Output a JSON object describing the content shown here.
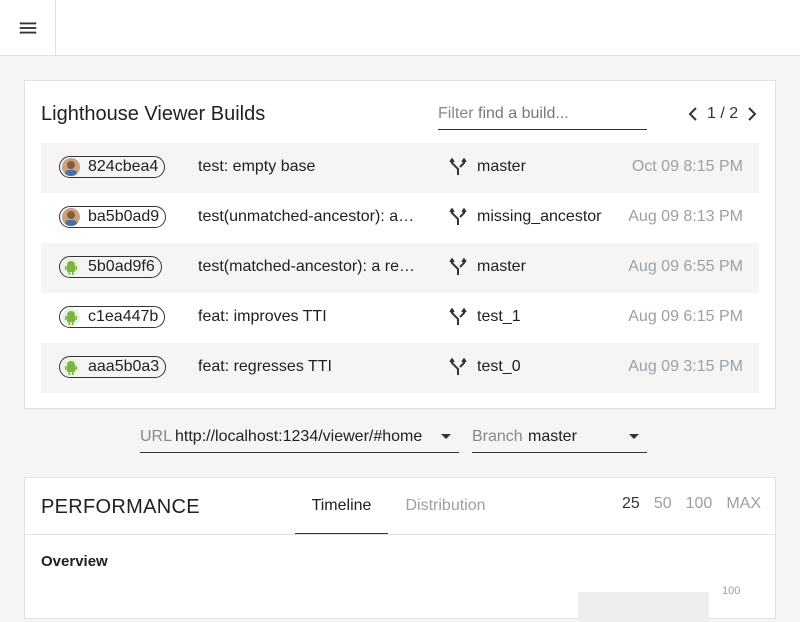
{
  "builds": {
    "title": "Lighthouse Viewer Builds",
    "filter": {
      "label": "Filter",
      "placeholder": "find a build..."
    },
    "pager": {
      "text": "1 / 2"
    },
    "rows": [
      {
        "hash": "824cbea4",
        "avatar": "person-avatar",
        "message": "test: empty base",
        "branch": "master",
        "date": "Oct 09 8:15 PM"
      },
      {
        "hash": "ba5b0ad9",
        "avatar": "person-avatar",
        "message": "test(unmatched-ancestor): a…",
        "branch": "missing_ancestor",
        "date": "Aug 09 8:13 PM"
      },
      {
        "hash": "5b0ad9f6",
        "avatar": "android-avatar",
        "message": "test(matched-ancestor): a re…",
        "branch": "master",
        "date": "Aug 09 6:55 PM"
      },
      {
        "hash": "c1ea447b",
        "avatar": "android-avatar",
        "message": "feat: improves TTI",
        "branch": "test_1",
        "date": "Aug 09 6:15 PM"
      },
      {
        "hash": "aaa5b0a3",
        "avatar": "android-avatar",
        "message": "feat: regresses TTI",
        "branch": "test_0",
        "date": "Aug 09 3:15 PM"
      }
    ]
  },
  "selectors": {
    "url": {
      "label": "URL",
      "value": "http://localhost:1234/viewer/#home"
    },
    "branch": {
      "label": "Branch",
      "value": "master"
    }
  },
  "performance": {
    "title": "PERFORMANCE",
    "tabs": [
      {
        "label": "Timeline",
        "active": true
      },
      {
        "label": "Distribution",
        "active": false
      }
    ],
    "zoom": [
      "25",
      "50",
      "100",
      "MAX"
    ],
    "zoom_selected": "25",
    "overview_label": "Overview",
    "chart_tick": "100"
  }
}
